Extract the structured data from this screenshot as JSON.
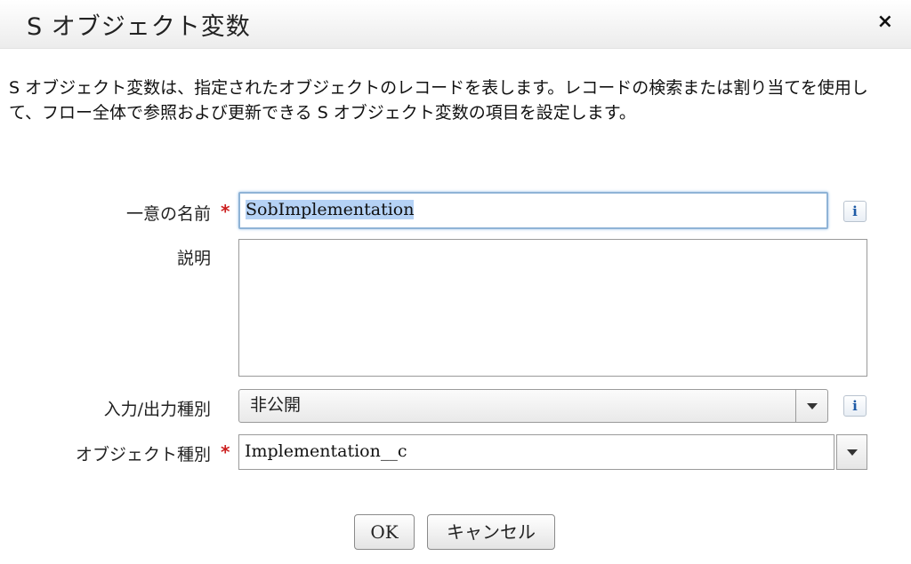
{
  "dialog": {
    "title": "S オブジェクト変数",
    "close_label": "×"
  },
  "description": "S オブジェクト変数は、指定されたオブジェクトのレコードを表します。レコードの検索または割り当てを使用して、フロー全体で参照および更新できる S オブジェクト変数の項目を設定します。",
  "form": {
    "unique_name": {
      "label": "一意の名前",
      "required_mark": "*",
      "value": "SobImplementation",
      "info_label": "i"
    },
    "description_field": {
      "label": "説明",
      "value": ""
    },
    "io_type": {
      "label": "入力/出力種別",
      "value": "非公開",
      "info_label": "i"
    },
    "object_type": {
      "label": "オブジェクト種別",
      "required_mark": "*",
      "value": "Implementation__c"
    }
  },
  "buttons": {
    "ok_label": "OK",
    "cancel_label": "キャンセル"
  },
  "colors": {
    "required": "#cc1f1f",
    "focus_border": "#8fb3d6",
    "selection": "#b5d2f5",
    "info_icon": "#1d5aa6"
  }
}
